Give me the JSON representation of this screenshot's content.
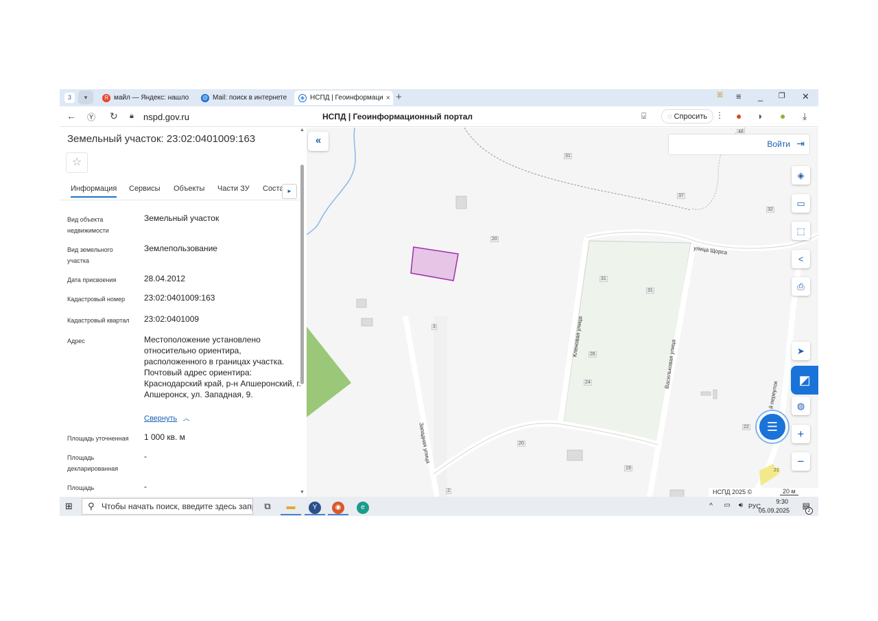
{
  "browser": {
    "tab_count": "3",
    "tabs": [
      {
        "label": "майл — Яндекс: нашлось"
      },
      {
        "label": "Mail: поиск в интернете"
      },
      {
        "label": "НСПД | Геоинформаци"
      }
    ],
    "url": "nspd.gov.ru",
    "page_title": "НСПД | Геоинформационный портал",
    "ask_label": "Спросить"
  },
  "panel": {
    "title": "Земельный участок: 23:02:0401009:163",
    "tabs": [
      "Информация",
      "Сервисы",
      "Объекты",
      "Части ЗУ",
      "Соста"
    ],
    "rows": [
      {
        "label": "Вид объекта недвижимости",
        "value": "Земельный участок"
      },
      {
        "label": "Вид земельного участка",
        "value": "Землепользование"
      },
      {
        "label": "Дата присвоения",
        "value": "28.04.2012"
      },
      {
        "label": "Кадастровый номер",
        "value": "23:02:0401009:163"
      },
      {
        "label": "Кадастровый квартал",
        "value": "23:02:0401009"
      },
      {
        "label": "Адрес",
        "value": "Местоположение установлено относительно ориентира, расположенного в границах участка. Почтовый адрес ориентира: Краснодарский край, р-н Апшеронский, г. Апшеронск, ул. Западная, 9."
      },
      {
        "label": "Площадь уточненная",
        "value": "1 000 кв. м"
      },
      {
        "label": "Площадь декларированная",
        "value": "-"
      },
      {
        "label": "Площадь",
        "value": "-"
      }
    ],
    "collapse_label": "Свернуть"
  },
  "map": {
    "login_label": "Войти",
    "streets": [
      "улица Щорса",
      "Кленовая улица",
      "Васильковая улица",
      "Западная улица",
      "й переулок"
    ],
    "house_numbers": [
      "31",
      "37",
      "32",
      "20",
      "31",
      "31",
      "3",
      "26",
      "24",
      "20",
      "19",
      "2",
      "22",
      "21",
      "48"
    ],
    "copyright": "НСПД 2025 ©",
    "scale": "20 м"
  },
  "taskbar": {
    "search_placeholder": "Чтобы начать поиск, введите здесь запрос",
    "language": "РУС",
    "time": "9:30",
    "date": "05.09.2025",
    "notifications": "2"
  }
}
